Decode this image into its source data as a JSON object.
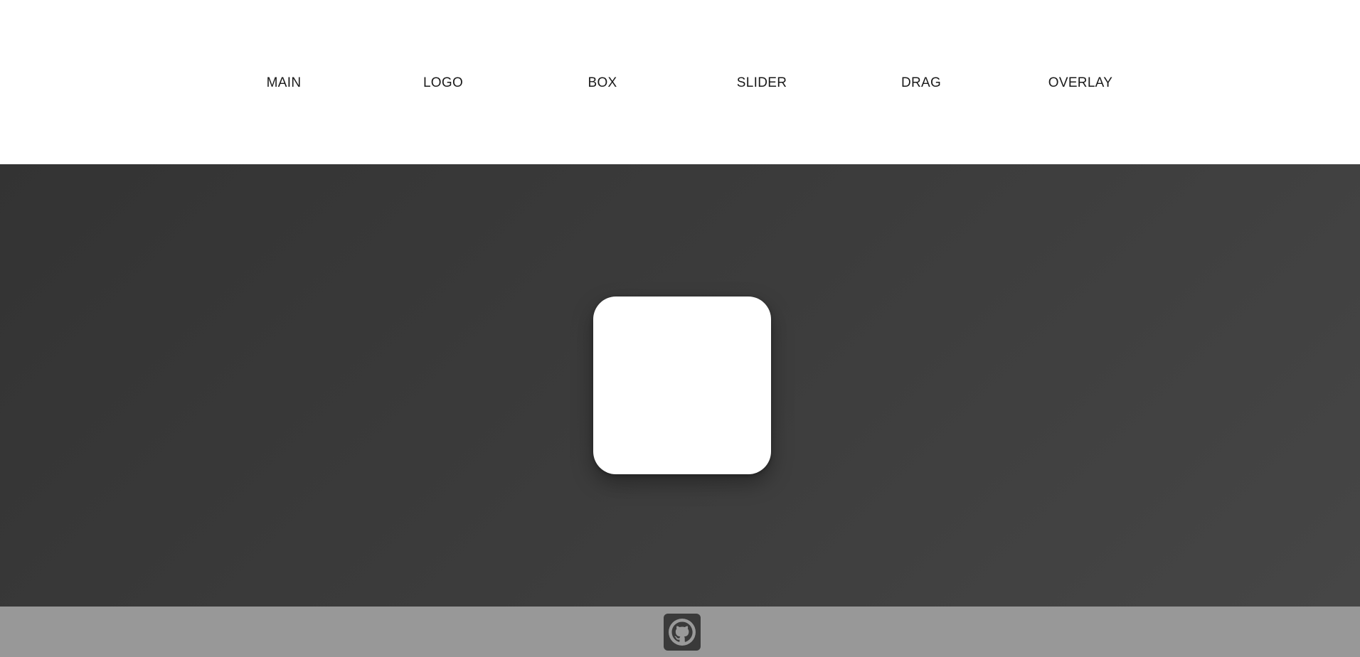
{
  "nav": {
    "items": [
      {
        "label": "MAIN"
      },
      {
        "label": "LOGO"
      },
      {
        "label": "BOX"
      },
      {
        "label": "SLIDER"
      },
      {
        "label": "DRAG"
      },
      {
        "label": "OVERLAY"
      }
    ]
  },
  "footer": {
    "icon": "github-icon"
  },
  "colors": {
    "nav_background": "#ffffff",
    "nav_text": "#1a1a1a",
    "hero_background_start": "#333333",
    "hero_background_end": "#464646",
    "box": "#ffffff",
    "footer_background": "#989898",
    "github_badge": "#3a3a3a"
  }
}
